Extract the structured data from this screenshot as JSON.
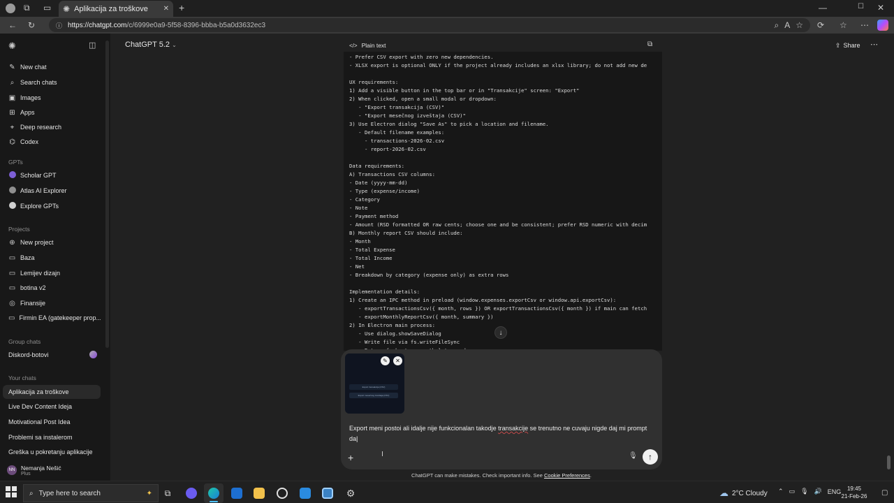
{
  "browser": {
    "tab_title": "Aplikacija za troškove",
    "url_host": "https://chatgpt.com",
    "url_path": "/c/6999e0a9-5f58-8396-bbba-b5a0d3632ec3"
  },
  "sidebar": {
    "top_items": [
      {
        "label": "New chat",
        "icon": "edit-icon"
      },
      {
        "label": "Search chats",
        "icon": "search-icon"
      },
      {
        "label": "Images",
        "icon": "image-icon"
      },
      {
        "label": "Apps",
        "icon": "grid-icon"
      },
      {
        "label": "Deep research",
        "icon": "telescope-icon"
      },
      {
        "label": "Codex",
        "icon": "codex-icon"
      }
    ],
    "gpts_heading": "GPTs",
    "gpts": [
      {
        "label": "Scholar GPT",
        "color": "#7d5fd6"
      },
      {
        "label": "Atlas AI Explorer",
        "color": "#8f8f8f"
      },
      {
        "label": "Explore GPTs",
        "color": "#d0d0d0"
      }
    ],
    "projects_heading": "Projects",
    "projects": [
      {
        "label": "New project",
        "icon": "folder-plus-icon"
      },
      {
        "label": "Baza",
        "icon": "folder-icon"
      },
      {
        "label": "Lemijev dizajn",
        "icon": "folder-icon"
      },
      {
        "label": "botina v2",
        "icon": "folder-icon"
      },
      {
        "label": "Finansije",
        "icon": "finance-icon"
      },
      {
        "label": "Firmin EA (gatekeeper prop...",
        "icon": "folder-icon"
      }
    ],
    "group_heading": "Group chats",
    "group_chats": [
      {
        "label": "Diskord-botovi"
      }
    ],
    "chats_heading": "Your chats",
    "chats": [
      {
        "label": "Aplikacija za troškove",
        "active": true
      },
      {
        "label": "Live Dev Content Ideja"
      },
      {
        "label": "Motivational Post Idea"
      },
      {
        "label": "Problemi sa instalerom"
      },
      {
        "label": "Greška u pokretanju aplikacije"
      }
    ],
    "user": {
      "initials": "NN",
      "name": "Nemanja Nešić",
      "plan": "Plus"
    }
  },
  "header": {
    "model": "ChatGPT 5.2",
    "share_label": "Share"
  },
  "code_block": {
    "language_label": "Plain text",
    "lines": [
      "- Prefer CSV export with zero new dependencies.",
      "- XLSX export is optional ONLY if the project already includes an xlsx library; do not add new de",
      "",
      "UX requirements:",
      "1) Add a visible button in the top bar or in \"Transakcije\" screen: \"Export\"",
      "2) When clicked, open a small modal or dropdown:",
      "   - \"Export transakcija (CSV)\"",
      "   - \"Export mesečnog izveštaja (CSV)\"",
      "3) Use Electron dialog \"Save As\" to pick a location and filename.",
      "   - Default filename examples:",
      "     - transactions-2026-02.csv",
      "     - report-2026-02.csv",
      "",
      "Data requirements:",
      "A) Transactions CSV columns:",
      "- Date (yyyy-mm-dd)",
      "- Type (expense/income)",
      "- Category",
      "- Note",
      "- Payment method",
      "- Amount (RSD formatted OR raw cents; choose one and be consistent; prefer RSD numeric with decim",
      "B) Monthly report CSV should include:",
      "- Month",
      "- Total Expense",
      "- Total Income",
      "- Net",
      "- Breakdown by category (expense only) as extra rows",
      "",
      "Implementation details:",
      "1) Create an IPC method in preload (window.expenses.exportCsv or window.api.exportCsv):",
      "   - exportTransactionsCsv({ month, rows }) OR exportTransactionsCsv({ month }) if main can fetch",
      "   - exportMonthlyReportCsv({ month, summary })",
      "2) In Electron main process:",
      "   - Use dialog.showSaveDialog",
      "   - Write file via fs.writeFileSync",
      "   - Return { ok: true, path } to renderer"
    ]
  },
  "composer": {
    "attachment_lines": [
      "Export transakcija (CSV)",
      "Export mesečnog izveštaja (CSV)"
    ],
    "text_before": "Export meni postoi ali idalje nije funkcionalan takodje ",
    "text_misspelled": "transakcije",
    "text_after": " se trenutno ne cuvaju nigde daj mi prompt da"
  },
  "disclaimer": {
    "text": "ChatGPT can make mistakes. Check important info. See ",
    "link": "Cookie Preferences",
    "end": "."
  },
  "taskbar": {
    "search_placeholder": "Type here to search",
    "weather": "2°C  Cloudy",
    "lang": "ENG",
    "time": "19:45",
    "date": "21-Feb-26"
  }
}
